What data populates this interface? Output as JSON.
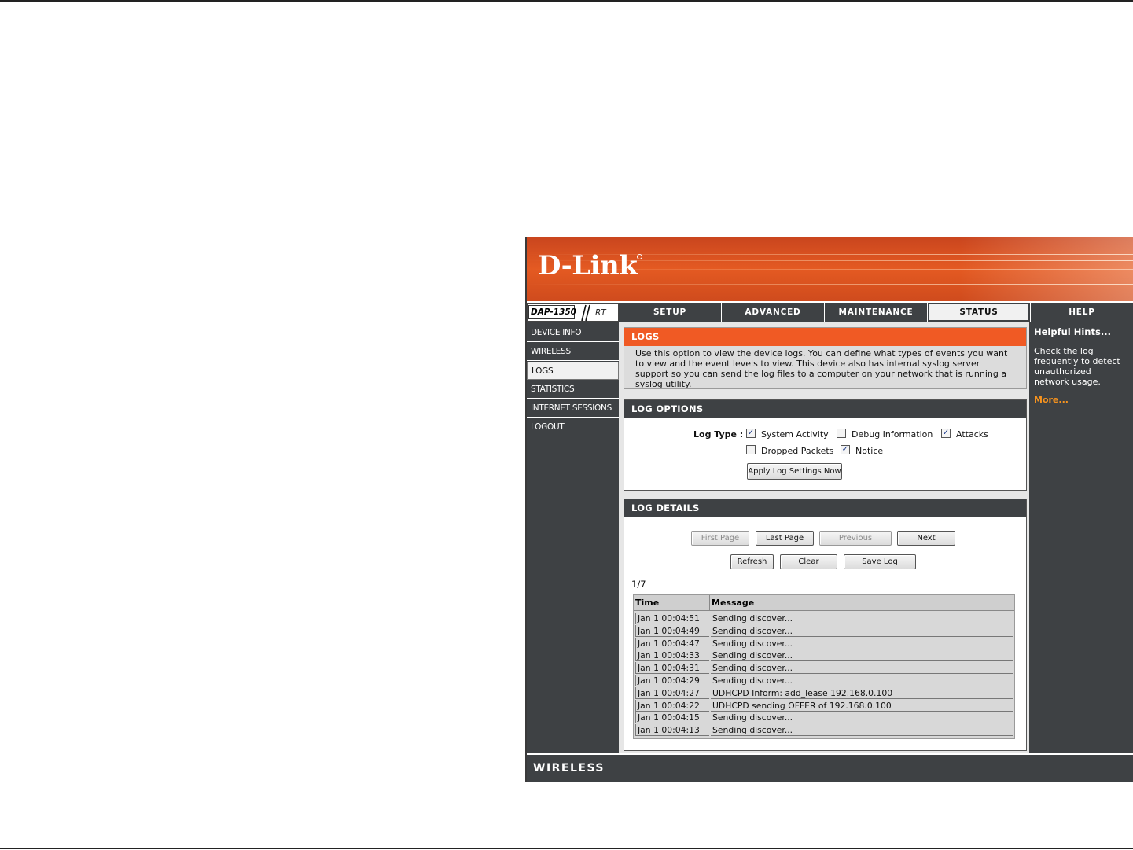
{
  "brand": {
    "logo_text": "D-Link",
    "accent_color": "#f05a24",
    "dark_color": "#3e4144"
  },
  "model": {
    "name": "DAP-1350",
    "revision": "RT"
  },
  "nav": {
    "tabs": [
      {
        "label": "SETUP"
      },
      {
        "label": "ADVANCED"
      },
      {
        "label": "MAINTENANCE"
      },
      {
        "label": "STATUS",
        "active": true
      },
      {
        "label": "HELP"
      }
    ]
  },
  "sidebar": {
    "items": [
      {
        "label": "DEVICE INFO"
      },
      {
        "label": "WIRELESS"
      },
      {
        "label": "LOGS",
        "active": true
      },
      {
        "label": "STATISTICS"
      },
      {
        "label": "INTERNET SESSIONS"
      },
      {
        "label": "LOGOUT"
      }
    ]
  },
  "intro": {
    "title": "LOGS",
    "text": "Use this option to view the device logs. You can define what types of events you want to view and the event levels to view. This device also has internal syslog server support so you can send the log files to a computer on your network that is running a syslog utility."
  },
  "log_options": {
    "title": "LOG OPTIONS",
    "log_type_label": "Log Type :",
    "options": [
      {
        "label": "System Activity",
        "checked": true
      },
      {
        "label": "Debug Information",
        "checked": false
      },
      {
        "label": "Attacks",
        "checked": true
      },
      {
        "label": "Dropped Packets",
        "checked": false
      },
      {
        "label": "Notice",
        "checked": true
      }
    ],
    "apply_label": "Apply Log Settings Now"
  },
  "log_details": {
    "title": "LOG DETAILS",
    "buttons": {
      "first_page": "First Page",
      "last_page": "Last Page",
      "previous": "Previous",
      "next": "Next",
      "refresh": "Refresh",
      "clear": "Clear",
      "save_log": "Save Log"
    },
    "page_indicator": "1/7",
    "columns": {
      "time": "Time",
      "message": "Message"
    },
    "rows": [
      {
        "time": "Jan 1 00:04:51",
        "message": "Sending discover..."
      },
      {
        "time": "Jan 1 00:04:49",
        "message": "Sending discover..."
      },
      {
        "time": "Jan 1 00:04:47",
        "message": "Sending discover..."
      },
      {
        "time": "Jan 1 00:04:33",
        "message": "Sending discover..."
      },
      {
        "time": "Jan 1 00:04:31",
        "message": "Sending discover..."
      },
      {
        "time": "Jan 1 00:04:29",
        "message": "Sending discover..."
      },
      {
        "time": "Jan 1 00:04:27",
        "message": "UDHCPD Inform: add_lease 192.168.0.100"
      },
      {
        "time": "Jan 1 00:04:22",
        "message": "UDHCPD sending OFFER of 192.168.0.100"
      },
      {
        "time": "Jan 1 00:04:15",
        "message": "Sending discover..."
      },
      {
        "time": "Jan 1 00:04:13",
        "message": "Sending discover..."
      }
    ]
  },
  "help": {
    "title": "Helpful Hints...",
    "text": "Check the log frequently to detect unauthorized network usage.",
    "more_label": "More..."
  },
  "footer": {
    "text": "WIRELESS"
  }
}
